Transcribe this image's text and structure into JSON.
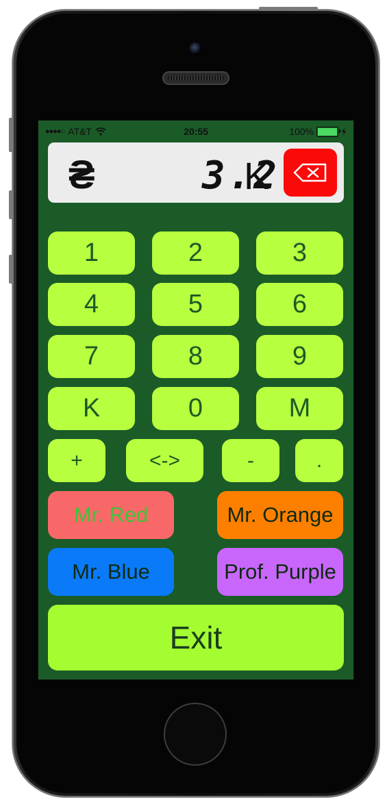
{
  "status_bar": {
    "signal": "●●●●○",
    "carrier": "AT&T",
    "time": "20:55",
    "battery": "100%"
  },
  "display": {
    "currency_symbol": "₴",
    "amount": "3.2",
    "unit": "K",
    "backspace_icon": "backspace-icon"
  },
  "keypad": {
    "rows": [
      [
        "1",
        "2",
        "3"
      ],
      [
        "4",
        "5",
        "6"
      ],
      [
        "7",
        "8",
        "9"
      ],
      [
        "K",
        "0",
        "M"
      ]
    ],
    "ops": [
      "+",
      "<->",
      "-",
      "."
    ]
  },
  "characters": {
    "red": {
      "label": "Mr. Red",
      "bg": "#f96868",
      "fg": "#3cc43a"
    },
    "orange": {
      "label": "Mr. Orange",
      "bg": "#fd7f00"
    },
    "blue": {
      "label": "Mr. Blue",
      "bg": "#0a7af9"
    },
    "purple": {
      "label": "Prof. Purple",
      "bg": "#c966fb"
    }
  },
  "exit_label": "Exit",
  "colors": {
    "screen_bg": "#1a5b28",
    "key_bg": "#b7ff3f",
    "key_text": "#1d5a26",
    "exit_bg": "#a4fd31",
    "backspace_bg": "#fb0a0a"
  }
}
